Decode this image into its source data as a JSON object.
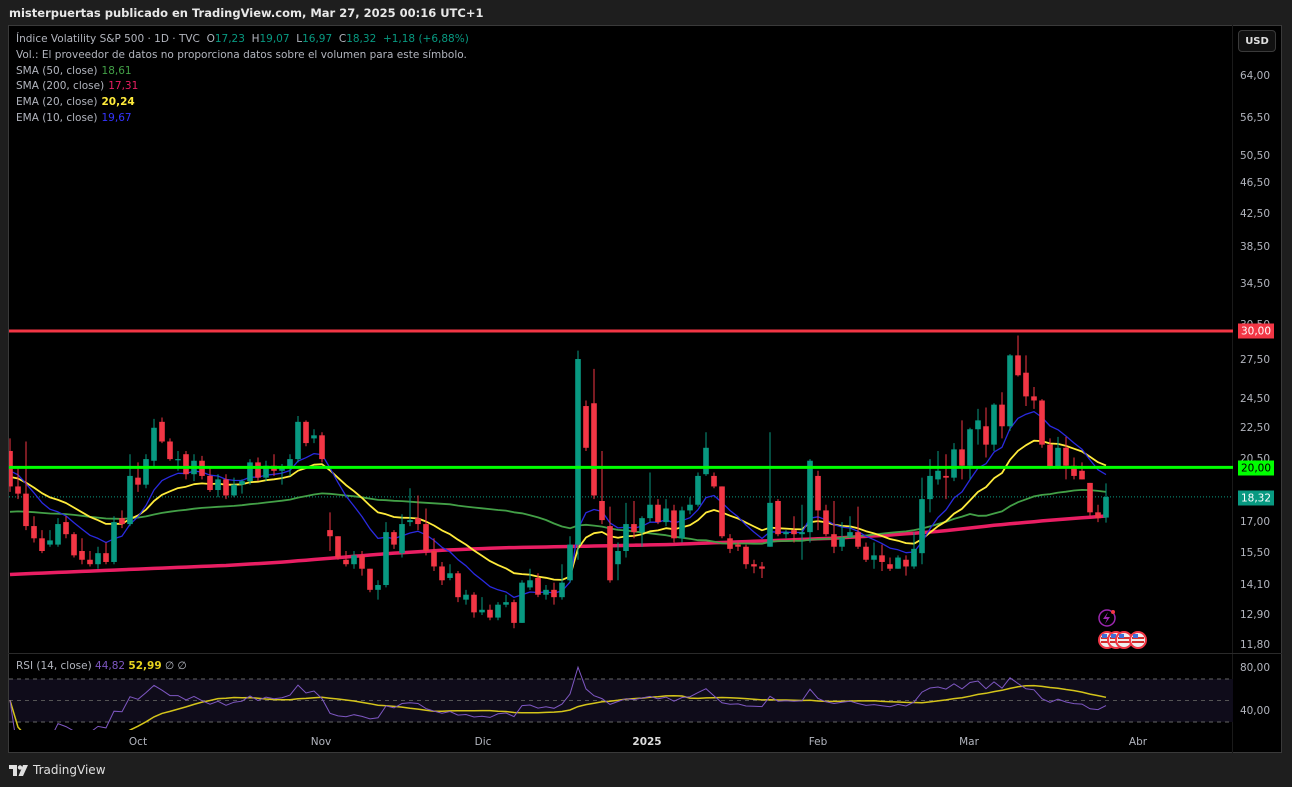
{
  "header": {
    "publisher_line": "misterpuertas publicado en TradingView.com, Mar 27, 2025 00:16 UTC+1",
    "symbol": "Índice Volatility S&P 500 · 1D · TVC",
    "o_label": "O",
    "o": "17,23",
    "h_label": "H",
    "h": "19,07",
    "l_label": "L",
    "l": "16,97",
    "c_label": "C",
    "c": "18,32",
    "change": "+1,18 (+6,88%)",
    "vol_note": "Vol.: El proveedor de datos no proporciona datos sobre el volumen para este símbolo."
  },
  "indicators": [
    {
      "name": "SMA (50, close)",
      "value": "18,61",
      "color": "#43a047"
    },
    {
      "name": "SMA (200, close)",
      "value": "17,31",
      "color": "#e91e63"
    },
    {
      "name": "EMA (20, close)",
      "value": "20,24",
      "color": "#ffeb3b"
    },
    {
      "name": "EMA (10, close)",
      "value": "19,67",
      "color": "#2a2ae0"
    }
  ],
  "rsi": {
    "label": "RSI (14, close)",
    "value": "44,82",
    "ma": "52,99",
    "extra1": "∅",
    "extra2": "∅",
    "ticks": [
      "80,00",
      "40,00"
    ]
  },
  "price_axis": {
    "currency": "USD",
    "ticks": [
      {
        "label": "64,00",
        "value": 64
      },
      {
        "label": "56,50",
        "value": 56.5
      },
      {
        "label": "50,50",
        "value": 50.5
      },
      {
        "label": "46,50",
        "value": 46.5
      },
      {
        "label": "42,50",
        "value": 42.5
      },
      {
        "label": "38,50",
        "value": 38.5
      },
      {
        "label": "34,50",
        "value": 34.5
      },
      {
        "label": "30,50",
        "value": 30.5
      },
      {
        "label": "27,50",
        "value": 27.5
      },
      {
        "label": "24,50",
        "value": 24.5
      },
      {
        "label": "22,50",
        "value": 22.5
      },
      {
        "label": "20,50",
        "value": 20.5
      },
      {
        "label": "17,00",
        "value": 17
      },
      {
        "label": "15,50",
        "value": 15.5
      },
      {
        "label": "14,10",
        "value": 14.1
      },
      {
        "label": "12,90",
        "value": 12.9
      },
      {
        "label": "11,80",
        "value": 11.8
      }
    ],
    "resistance": {
      "label": "30,00",
      "value": 30,
      "color": "#f23645"
    },
    "support": {
      "label": "20,00",
      "value": 20,
      "color": "#00ff00"
    },
    "last": {
      "label": "18,32",
      "value": 18.32,
      "color": "#089981"
    }
  },
  "time_axis": [
    "Oct",
    "Nov",
    "Dic",
    "2025",
    "Feb",
    "Mar",
    "Abr"
  ],
  "footer": {
    "brand": "TradingView"
  },
  "colors": {
    "up": "#089981",
    "down": "#f23645",
    "rsi": "#7e57c2",
    "rsi_ma": "#d4c41a"
  },
  "chart_data": {
    "type": "candlestick",
    "title": "Índice Volatility S&P 500 · 1D · TVC",
    "scale": "log",
    "ylim": [
      11.8,
      64
    ],
    "x_labels": [
      "Oct",
      "Nov",
      "Dic",
      "2025",
      "Feb",
      "Mar",
      "Abr"
    ],
    "candles_ohlc": [
      [
        21.0,
        21.8,
        18.6,
        18.9
      ],
      [
        18.9,
        20.0,
        18.2,
        18.5
      ],
      [
        18.5,
        21.6,
        16.6,
        16.8
      ],
      [
        16.8,
        17.3,
        16.0,
        16.2
      ],
      [
        16.2,
        16.6,
        15.5,
        15.6
      ],
      [
        15.9,
        16.6,
        15.8,
        16.1
      ],
      [
        15.9,
        17.2,
        15.8,
        16.9
      ],
      [
        17.0,
        17.3,
        16.2,
        16.4
      ],
      [
        16.4,
        16.5,
        15.3,
        15.4
      ],
      [
        15.6,
        16.2,
        15.0,
        15.2
      ],
      [
        15.2,
        15.6,
        14.9,
        15.0
      ],
      [
        15.0,
        15.8,
        14.8,
        15.5
      ],
      [
        15.5,
        16.0,
        15.0,
        15.1
      ],
      [
        15.1,
        17.3,
        15.0,
        17.0
      ],
      [
        17.2,
        17.6,
        16.7,
        16.9
      ],
      [
        16.9,
        20.8,
        16.8,
        19.5
      ],
      [
        19.4,
        20.3,
        18.6,
        19.0
      ],
      [
        19.0,
        20.8,
        18.8,
        20.5
      ],
      [
        20.4,
        23.1,
        20.0,
        22.5
      ],
      [
        22.9,
        23.2,
        21.5,
        21.6
      ],
      [
        21.6,
        21.8,
        20.4,
        20.5
      ],
      [
        20.5,
        21.0,
        19.8,
        20.5
      ],
      [
        20.8,
        21.0,
        19.3,
        19.6
      ],
      [
        19.6,
        20.8,
        19.2,
        20.4
      ],
      [
        20.4,
        20.7,
        19.3,
        19.5
      ],
      [
        19.5,
        20.0,
        18.6,
        18.7
      ],
      [
        18.7,
        19.6,
        18.3,
        19.3
      ],
      [
        19.3,
        19.6,
        18.2,
        18.4
      ],
      [
        18.4,
        19.4,
        18.3,
        19.0
      ],
      [
        19.0,
        19.3,
        18.5,
        19.2
      ],
      [
        19.2,
        20.5,
        19.0,
        20.3
      ],
      [
        20.3,
        20.6,
        19.2,
        19.4
      ],
      [
        19.4,
        20.4,
        19.2,
        20.1
      ],
      [
        20.1,
        20.8,
        19.5,
        19.8
      ],
      [
        19.8,
        20.2,
        19.0,
        20.0
      ],
      [
        20.0,
        20.8,
        19.5,
        20.5
      ],
      [
        20.5,
        23.3,
        20.3,
        22.9
      ],
      [
        22.9,
        23.0,
        21.3,
        21.5
      ],
      [
        21.8,
        22.4,
        21.5,
        22.0
      ],
      [
        22.0,
        22.2,
        20.3,
        20.5
      ],
      [
        16.6,
        17.5,
        15.6,
        16.3
      ],
      [
        16.3,
        16.3,
        15.2,
        15.3
      ],
      [
        15.2,
        15.6,
        14.9,
        15.0
      ],
      [
        15.0,
        15.6,
        14.8,
        15.4
      ],
      [
        15.4,
        15.6,
        14.5,
        14.8
      ],
      [
        14.8,
        14.8,
        13.8,
        13.9
      ],
      [
        13.9,
        14.3,
        13.5,
        14.1
      ],
      [
        14.1,
        17.0,
        14.0,
        16.5
      ],
      [
        16.5,
        16.6,
        15.7,
        15.9
      ],
      [
        15.5,
        17.4,
        15.3,
        16.9
      ],
      [
        17.0,
        18.8,
        16.8,
        17.1
      ],
      [
        17.2,
        18.4,
        16.6,
        16.9
      ],
      [
        16.9,
        17.7,
        15.4,
        15.6
      ],
      [
        15.6,
        16.2,
        14.7,
        14.9
      ],
      [
        14.9,
        15.1,
        14.1,
        14.3
      ],
      [
        14.4,
        15.0,
        14.3,
        14.6
      ],
      [
        14.6,
        14.7,
        13.4,
        13.6
      ],
      [
        13.5,
        13.9,
        13.3,
        13.7
      ],
      [
        13.7,
        13.8,
        12.8,
        13.0
      ],
      [
        13.0,
        13.6,
        12.9,
        13.1
      ],
      [
        13.1,
        13.3,
        12.7,
        12.8
      ],
      [
        12.8,
        13.4,
        12.7,
        13.3
      ],
      [
        13.3,
        13.7,
        13.2,
        13.4
      ],
      [
        13.4,
        13.5,
        12.4,
        12.6
      ],
      [
        12.6,
        14.3,
        12.6,
        14.2
      ],
      [
        14.0,
        14.8,
        13.9,
        14.3
      ],
      [
        14.4,
        14.6,
        13.6,
        13.7
      ],
      [
        13.7,
        14.1,
        13.5,
        13.9
      ],
      [
        13.9,
        14.2,
        13.3,
        13.6
      ],
      [
        13.6,
        15.0,
        13.5,
        14.2
      ],
      [
        14.3,
        16.3,
        14.2,
        15.9
      ],
      [
        15.9,
        28.3,
        15.2,
        27.6
      ],
      [
        24.0,
        24.4,
        21.0,
        21.2
      ],
      [
        24.2,
        26.8,
        18.2,
        18.4
      ],
      [
        18.1,
        21.0,
        16.9,
        17.1
      ],
      [
        16.8,
        17.8,
        14.2,
        14.3
      ],
      [
        15.0,
        16.0,
        14.3,
        15.6
      ],
      [
        15.6,
        18.0,
        15.3,
        16.9
      ],
      [
        16.9,
        18.1,
        16.2,
        16.5
      ],
      [
        16.5,
        17.3,
        15.8,
        17.2
      ],
      [
        17.2,
        19.7,
        17.0,
        17.9
      ],
      [
        17.9,
        18.2,
        16.9,
        17.0
      ],
      [
        17.0,
        18.2,
        16.8,
        17.7
      ],
      [
        17.6,
        17.9,
        16.0,
        16.2
      ],
      [
        16.2,
        17.8,
        16.0,
        17.6
      ],
      [
        17.6,
        18.3,
        17.4,
        17.9
      ],
      [
        17.9,
        19.7,
        17.8,
        19.5
      ],
      [
        19.6,
        22.2,
        19.5,
        21.2
      ],
      [
        19.5,
        19.7,
        18.8,
        18.9
      ],
      [
        18.9,
        18.9,
        16.2,
        16.3
      ],
      [
        16.2,
        16.4,
        15.5,
        15.7
      ],
      [
        15.9,
        16.0,
        15.6,
        15.8
      ],
      [
        15.8,
        15.9,
        14.8,
        15.0
      ],
      [
        15.0,
        15.2,
        14.6,
        14.9
      ],
      [
        14.9,
        15.1,
        14.4,
        14.8
      ],
      [
        15.8,
        22.2,
        15.8,
        18.0
      ],
      [
        18.1,
        18.2,
        16.3,
        16.4
      ],
      [
        16.4,
        16.6,
        16.2,
        16.5
      ],
      [
        16.6,
        17.3,
        16.0,
        16.4
      ],
      [
        16.4,
        17.9,
        15.2,
        16.5
      ],
      [
        16.5,
        20.5,
        16.0,
        20.4
      ],
      [
        19.5,
        19.8,
        16.6,
        17.6
      ],
      [
        17.6,
        17.9,
        16.3,
        16.4
      ],
      [
        16.4,
        18.1,
        15.5,
        15.8
      ],
      [
        15.8,
        17.0,
        15.6,
        16.2
      ],
      [
        16.3,
        17.3,
        16.2,
        16.5
      ],
      [
        16.5,
        17.8,
        15.7,
        15.8
      ],
      [
        15.8,
        16.0,
        15.1,
        15.2
      ],
      [
        15.2,
        16.0,
        14.8,
        15.4
      ],
      [
        15.4,
        15.9,
        14.7,
        15.1
      ],
      [
        15.0,
        15.3,
        14.7,
        14.8
      ],
      [
        14.8,
        15.4,
        14.8,
        15.3
      ],
      [
        15.2,
        15.4,
        14.5,
        14.9
      ],
      [
        14.9,
        16.5,
        14.8,
        15.7
      ],
      [
        15.5,
        19.4,
        15.0,
        18.2
      ],
      [
        18.2,
        20.5,
        17.5,
        19.5
      ],
      [
        19.3,
        21.0,
        19.0,
        19.8
      ],
      [
        19.5,
        20.8,
        18.2,
        19.4
      ],
      [
        19.4,
        21.5,
        19.2,
        21.1
      ],
      [
        21.1,
        23.0,
        19.3,
        20.1
      ],
      [
        20.1,
        22.5,
        19.3,
        22.4
      ],
      [
        22.4,
        23.8,
        21.4,
        23.0
      ],
      [
        22.6,
        23.9,
        20.6,
        21.4
      ],
      [
        21.4,
        24.2,
        21.0,
        24.1
      ],
      [
        24.1,
        25.0,
        21.8,
        22.6
      ],
      [
        22.6,
        28.0,
        22.3,
        27.9
      ],
      [
        27.9,
        29.6,
        26.2,
        26.3
      ],
      [
        26.5,
        27.9,
        24.0,
        24.7
      ],
      [
        24.7,
        25.4,
        23.8,
        24.4
      ],
      [
        24.4,
        24.5,
        21.2,
        21.4
      ],
      [
        21.4,
        21.8,
        19.9,
        20.0
      ],
      [
        20.0,
        21.9,
        19.9,
        21.2
      ],
      [
        21.2,
        21.9,
        19.3,
        20.1
      ],
      [
        20.1,
        20.6,
        19.3,
        19.5
      ],
      [
        19.8,
        20.3,
        19.3,
        19.3
      ],
      [
        19.1,
        19.1,
        17.3,
        17.5
      ],
      [
        17.5,
        17.9,
        17.0,
        17.2
      ],
      [
        17.23,
        19.07,
        16.97,
        18.32
      ]
    ],
    "sma200_samples": [
      14.55,
      14.65,
      14.75,
      14.85,
      14.95,
      15.1,
      15.3,
      15.5,
      15.65,
      15.75,
      15.8,
      15.85,
      15.9,
      16.0,
      16.1,
      16.2,
      16.35,
      16.55,
      16.85,
      17.1,
      17.31
    ],
    "horizontal_levels": [
      30,
      20
    ],
    "rsi_range": [
      20,
      90
    ],
    "rsi_levels": [
      70,
      50,
      30
    ]
  }
}
